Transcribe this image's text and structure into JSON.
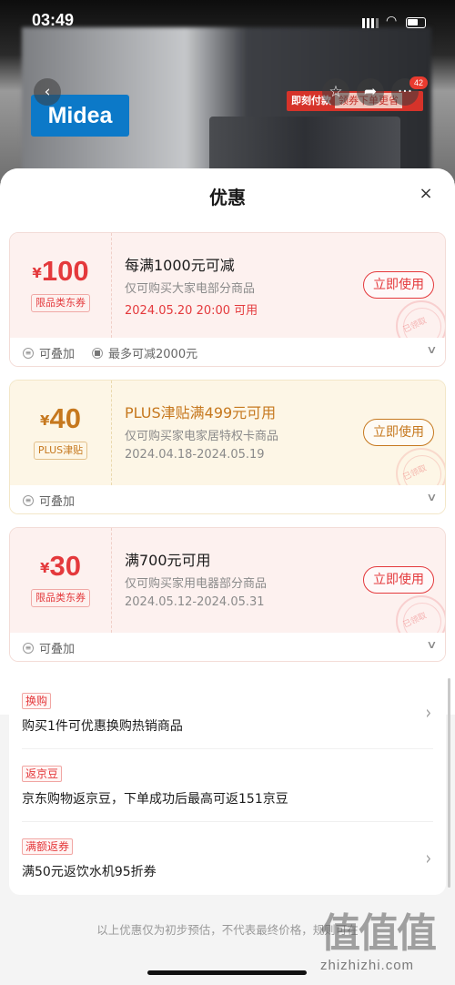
{
  "status_bar": {
    "time": "03:49"
  },
  "background_page": {
    "brand_logo": "Midea",
    "promo_text": "即刻付款",
    "promo_sub": "领券下单更省",
    "more_badge": "42",
    "icons": [
      "back-icon",
      "star-icon",
      "share-icon",
      "more-icon"
    ]
  },
  "sheet": {
    "title": "优惠",
    "close_icon": "×"
  },
  "coupons": [
    {
      "style": "red",
      "currency": "¥",
      "amount": "100",
      "tag": "限品类东券",
      "line1": "每满1000元可减",
      "line2": "仅可购买大家电部分商品",
      "line3": "2024.05.20 20:00 可用",
      "button": "立即使用",
      "stamp": "已领取",
      "feature1": "可叠加",
      "feature2": "最多可减2000元"
    },
    {
      "style": "gold",
      "currency": "¥",
      "amount": "40",
      "tag": "PLUS津贴",
      "line1": "PLUS津贴满499元可用",
      "line2": "仅可购买家电家居特权卡商品",
      "line3": "2024.04.18-2024.05.19",
      "button": "立即使用",
      "stamp": "已领取",
      "feature1": "可叠加"
    },
    {
      "style": "red",
      "currency": "¥",
      "amount": "30",
      "tag": "限品类东券",
      "line1": "满700元可用",
      "line2": "仅可购买家用电器部分商品",
      "line3": "2024.05.12-2024.05.31",
      "button": "立即使用",
      "stamp": "已领取",
      "feature1": "可叠加"
    }
  ],
  "benefits": [
    {
      "tag": "换购",
      "text": "购买1件可优惠换购热销商品",
      "has_arrow": true
    },
    {
      "tag": "返京豆",
      "text": "京东购物返京豆，下单成功后最高可返151京豆",
      "has_arrow": false
    },
    {
      "tag": "满额返券",
      "text": "满50元返饮水机95折券",
      "has_arrow": true
    }
  ],
  "disclaimer": "以上优惠仅为初步预估，不代表最终价格，规则可在",
  "watermark": {
    "logo": "值值值",
    "url": "zhizhizhi.com"
  }
}
